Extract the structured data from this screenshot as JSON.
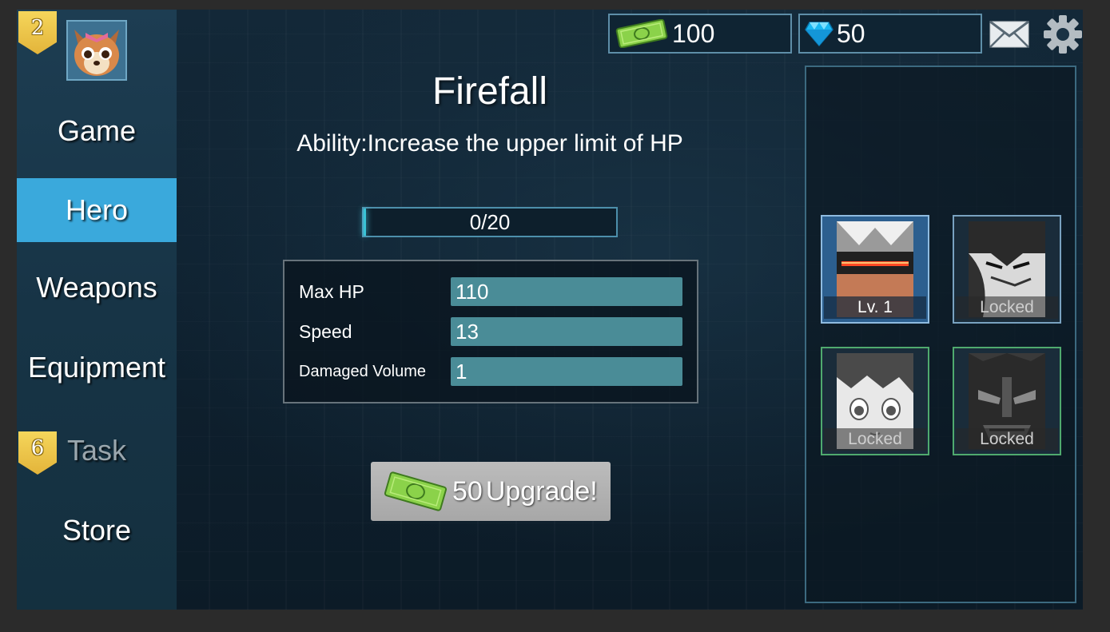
{
  "player": {
    "level": "2",
    "avatar": "dog-avatar-icon"
  },
  "nav": {
    "items": [
      {
        "label": "Game"
      },
      {
        "label": "Hero"
      },
      {
        "label": "Weapons"
      },
      {
        "label": "Equipment"
      },
      {
        "label": "Task",
        "badge": "6"
      },
      {
        "label": "Store"
      }
    ],
    "active": "Hero"
  },
  "currency": {
    "cash": "100",
    "cash_icon": "cash-icon",
    "gems": "50",
    "gems_icon": "diamond-icon"
  },
  "hero": {
    "name": "Firefall",
    "ability": "Ability:Increase the upper limit of HP",
    "exp_text": "0/20",
    "exp_progress": 0.0,
    "stats": [
      {
        "label": "Max HP",
        "value": "110"
      },
      {
        "label": "Speed",
        "value": "13"
      },
      {
        "label": "Damaged Volume",
        "value": "1"
      }
    ]
  },
  "upgrade": {
    "cost": "50",
    "label": "Upgrade!"
  },
  "heroes": [
    {
      "caption": "Lv. 1",
      "state": "selected",
      "art": "visor-robot-hero-icon"
    },
    {
      "caption": "Locked",
      "state": "locked",
      "art": "masked-ninja-hero-icon"
    },
    {
      "caption": "Locked",
      "state": "locked",
      "art": "anime-girl-hero-icon"
    },
    {
      "caption": "Locked",
      "state": "locked",
      "art": "demon-mask-hero-icon"
    }
  ],
  "colors": {
    "nav_active": "#3aa9dc",
    "stat_bar": "#4a8c97",
    "badge": "#f5d65b",
    "exp_glow": "#39c4d6"
  }
}
